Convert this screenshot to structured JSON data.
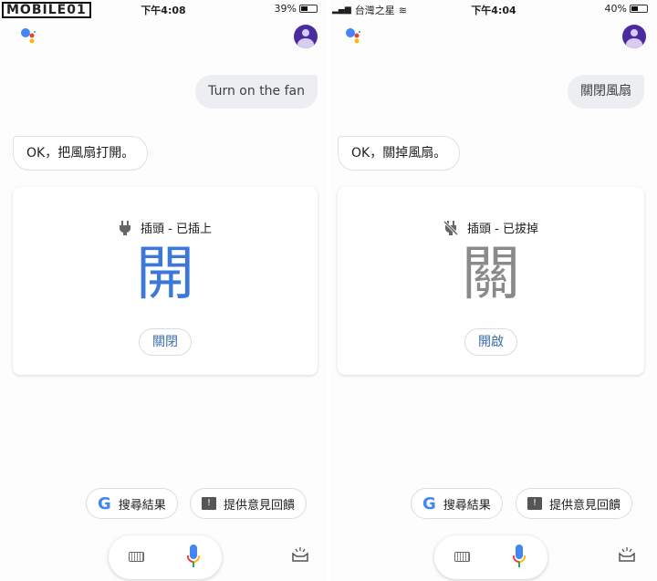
{
  "watermark": "mobile01",
  "panels": [
    {
      "status": {
        "time": "下午4:08",
        "battery": "39%",
        "battery_level": 0.39
      },
      "user_query": "Turn on the fan",
      "reply": "OK，把風扇打開。",
      "card": {
        "plug_status": "插頭 - 已插上",
        "plug_icon": "plug-icon",
        "state": "開",
        "state_color": "#3b78d8",
        "toggle_label": "關閉"
      },
      "chips": {
        "search": "搜尋結果",
        "feedback": "提供意見回饋"
      }
    },
    {
      "status": {
        "carrier": "台灣之星",
        "time": "下午4:04",
        "battery": "40%",
        "battery_level": 0.4
      },
      "user_query": "關閉風扇",
      "reply": "OK，關掉風扇。",
      "card": {
        "plug_status": "插頭 - 已拔掉",
        "plug_icon": "plug-off-icon",
        "state": "關",
        "state_color": "#8a8a8a",
        "toggle_label": "開啟"
      },
      "chips": {
        "search": "搜尋結果",
        "feedback": "提供意見回饋"
      }
    }
  ]
}
